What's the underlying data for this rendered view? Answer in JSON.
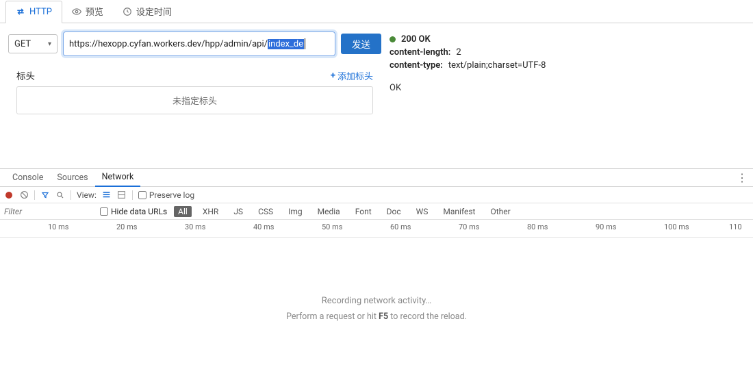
{
  "top_tabs": {
    "http": "HTTP",
    "preview": "预览",
    "timing": "设定时间"
  },
  "request": {
    "method": "GET",
    "url_prefix": "https://hexopp.cyfan.workers.dev/hpp/admin/api/",
    "url_selected": "index_de",
    "send_label": "发送"
  },
  "headers": {
    "title": "标头",
    "add_label": "添加标头",
    "empty_text": "未指定标头"
  },
  "response": {
    "status": "200 OK",
    "content_length_key": "content-length:",
    "content_length_val": "2",
    "content_type_key": "content-type:",
    "content_type_val": "text/plain;charset=UTF-8",
    "body": "OK"
  },
  "devtools": {
    "tabs": {
      "console": "Console",
      "sources": "Sources",
      "network": "Network"
    },
    "toolbar": {
      "view_label": "View:",
      "preserve_log": "Preserve log"
    },
    "filter": {
      "placeholder": "Filter",
      "hide_data_urls": "Hide data URLs",
      "types": [
        "All",
        "XHR",
        "JS",
        "CSS",
        "Img",
        "Media",
        "Font",
        "Doc",
        "WS",
        "Manifest",
        "Other"
      ]
    },
    "timeline_ticks": [
      "10 ms",
      "20 ms",
      "30 ms",
      "40 ms",
      "50 ms",
      "60 ms",
      "70 ms",
      "80 ms",
      "90 ms",
      "100 ms",
      "110"
    ],
    "recording": {
      "line1": "Recording network activity…",
      "line2_a": "Perform a request or hit ",
      "line2_b": "F5",
      "line2_c": " to record the reload."
    }
  }
}
